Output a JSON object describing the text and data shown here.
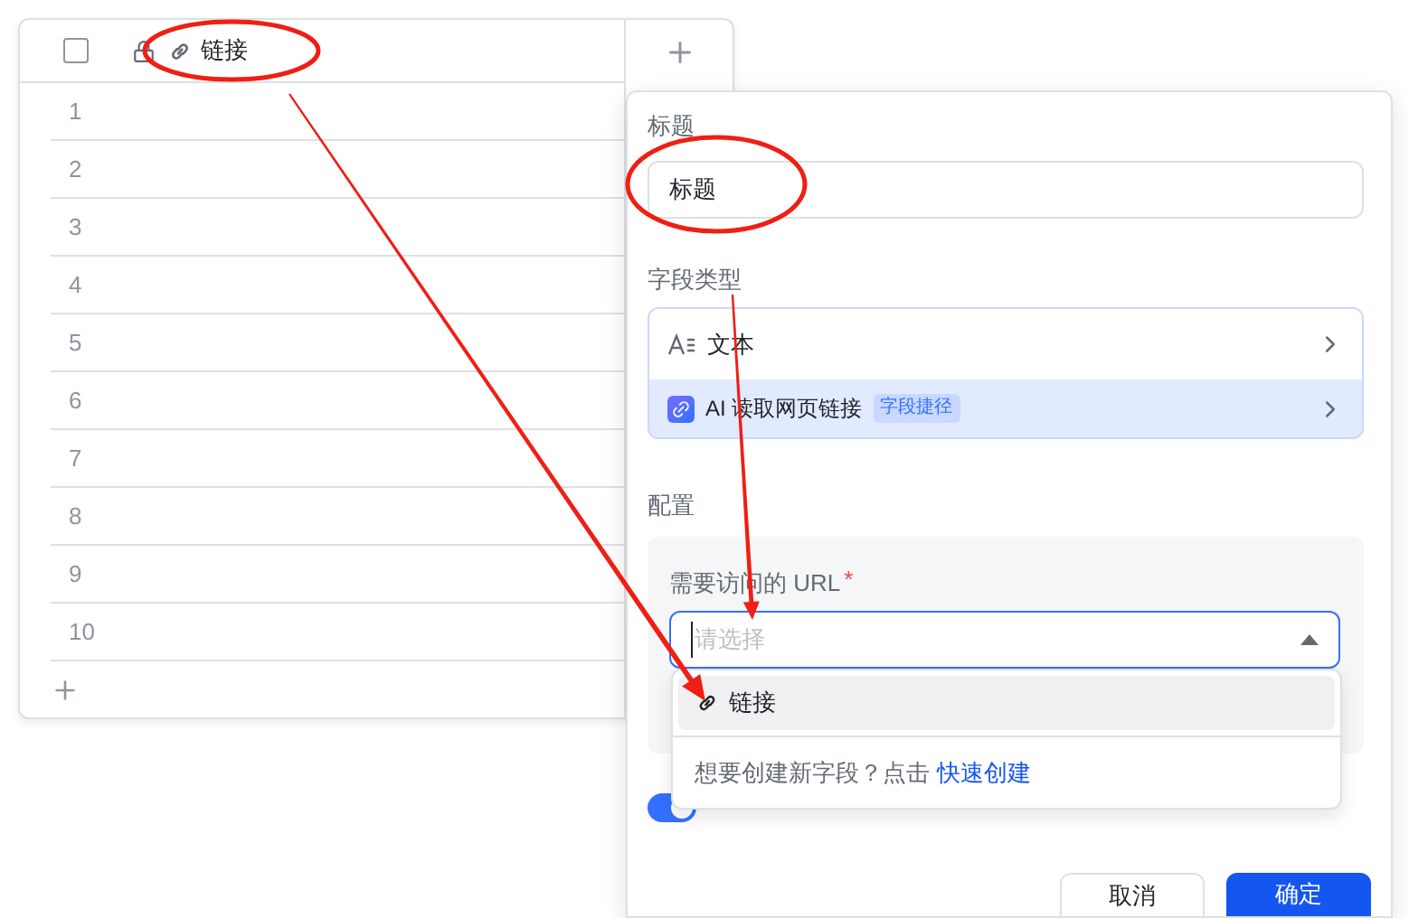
{
  "table": {
    "select_all": {
      "checked": false
    },
    "column_label": "链接",
    "rows": [
      "1",
      "2",
      "3",
      "4",
      "5",
      "6",
      "7",
      "8",
      "9",
      "10"
    ]
  },
  "panel": {
    "title_label": "标题",
    "title_value": "标题",
    "type_label": "字段类型",
    "types": [
      {
        "kind": "text",
        "label": "文本",
        "selected": false
      },
      {
        "kind": "ai",
        "label": "AI 读取网页链接",
        "badge": "字段捷径",
        "selected": true
      }
    ],
    "config_label": "配置",
    "url_label": "需要访问的 URL",
    "required_mark": "*",
    "select_placeholder": "请选择",
    "expanded": true,
    "options": [
      {
        "label": "链接",
        "selected": true
      }
    ],
    "create_hint": "想要创建新字段？点击",
    "create_link": "快速创建",
    "auto_update": {
      "on": true
    },
    "buttons": [
      {
        "kind": "secondary",
        "label": "取消"
      },
      {
        "kind": "primary",
        "label": "确定"
      }
    ]
  }
}
